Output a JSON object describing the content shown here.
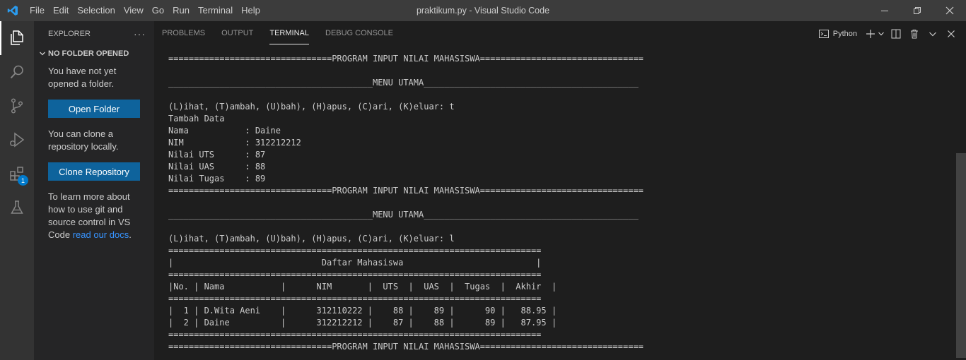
{
  "window": {
    "title": "praktikum.py - Visual Studio Code",
    "menu": [
      "File",
      "Edit",
      "Selection",
      "View",
      "Go",
      "Run",
      "Terminal",
      "Help"
    ]
  },
  "activity_bar": {
    "items": [
      {
        "icon": "files-icon",
        "active": true
      },
      {
        "icon": "search-icon"
      },
      {
        "icon": "source-control-icon"
      },
      {
        "icon": "run-debug-icon"
      },
      {
        "icon": "extensions-icon",
        "badge": "1"
      },
      {
        "icon": "testing-flask-icon"
      }
    ]
  },
  "sidebar": {
    "title": "EXPLORER",
    "more": "···",
    "section_title": "NO FOLDER OPENED",
    "text1": "You have not yet opened a folder.",
    "open_folder": "Open Folder",
    "text2": "You can clone a repository locally.",
    "clone_repo": "Clone Repository",
    "text3": "To learn more about how to use git and source control in VS Code ",
    "link": "read our docs",
    "text3_end": "."
  },
  "panel": {
    "tabs": [
      "PROBLEMS",
      "OUTPUT",
      "TERMINAL",
      "DEBUG CONSOLE"
    ],
    "active_tab": "TERMINAL",
    "terminal_name": "Python"
  },
  "terminal_lines": [
    "================================PROGRAM INPUT NILAI MAHASISWA================================",
    "",
    "________________________________________MENU UTAMA__________________________________________",
    "",
    "(L)ihat, (T)ambah, (U)bah), (H)apus, (C)ari, (K)eluar: t",
    "Tambah Data",
    "Nama           : Daine",
    "NIM            : 312212212",
    "Nilai UTS      : 87",
    "Nilai UAS      : 88",
    "Nilai Tugas    : 89",
    "================================PROGRAM INPUT NILAI MAHASISWA================================",
    "",
    "________________________________________MENU UTAMA__________________________________________",
    "",
    "(L)ihat, (T)ambah, (U)bah), (H)apus, (C)ari, (K)eluar: l",
    "=========================================================================",
    "|                             Daftar Mahasiswa                          |",
    "=========================================================================",
    "|No. | Nama           |      NIM       |  UTS  |  UAS  |  Tugas  |  Akhir  |",
    "=========================================================================",
    "|  1 | D.Wita Aeni    |      312110222 |    88 |    89 |      90 |   88.95 |",
    "|  2 | Daine          |      312212212 |    87 |    88 |      89 |   87.95 |",
    "=========================================================================",
    "================================PROGRAM INPUT NILAI MAHASISWA================================"
  ]
}
